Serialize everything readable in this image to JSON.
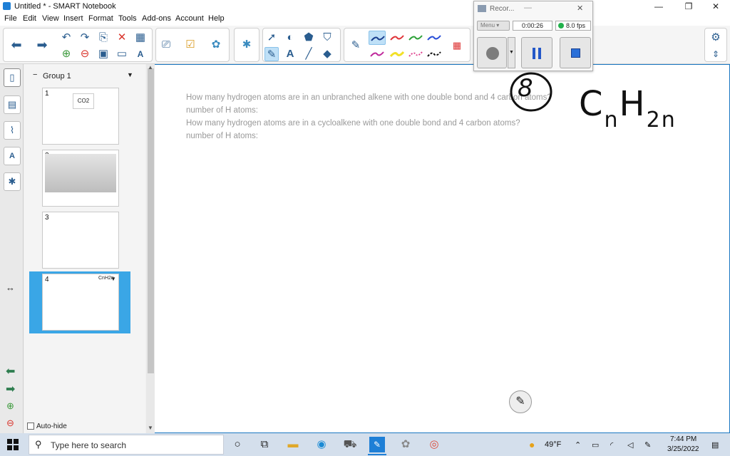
{
  "window": {
    "title": "Untitled * - SMART Notebook",
    "controls": {
      "minimize": "—",
      "maximize": "❐",
      "close": "✕"
    }
  },
  "menu": [
    "File",
    "Edit",
    "View",
    "Insert",
    "Format",
    "Tools",
    "Add-ons",
    "Account",
    "Help"
  ],
  "sorter": {
    "group_label": "Group 1",
    "pages": [
      {
        "number": "1",
        "preview_text": "CO2"
      },
      {
        "number": "2",
        "preview_text": ""
      },
      {
        "number": "3",
        "preview_text": ""
      },
      {
        "number": "4",
        "preview_text": "CnH2n"
      }
    ],
    "selected_page": 4,
    "auto_hide_label": "Auto-hide"
  },
  "page": {
    "lines": [
      "How many hydrogen atoms are in an unbranched alkene with one double bond and 4 carbon atoms?",
      "number of H atoms:",
      "How many hydrogen atoms are in a cycloalkene with one double bond and 4 carbon atoms?",
      "number of H atoms:"
    ],
    "handwriting": {
      "answer": "8",
      "formula": "CnH2n"
    }
  },
  "recorder": {
    "title": "Recor...",
    "menu_label": "Menu",
    "time": "0:00:26",
    "fps": "8.0 fps",
    "status_color": "#22b14c"
  },
  "taskbar": {
    "search_placeholder": "Type here to search",
    "weather": "49°F",
    "time": "7:44 PM",
    "date": "3/25/2022"
  },
  "colors": {
    "accent": "#1e7fd6",
    "selected_thumb": "#3aa6e6",
    "question_text": "#9a9a9a"
  }
}
